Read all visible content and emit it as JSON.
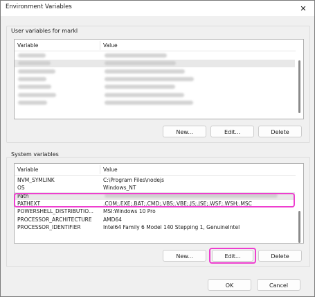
{
  "window": {
    "title": "Environment Variables",
    "close_icon": "close-icon"
  },
  "user_group": {
    "label": "User variables for markl",
    "columns": [
      "Variable",
      "Value"
    ],
    "rows": [
      {
        "variable": "",
        "value": ""
      },
      {
        "variable": "",
        "value": ""
      },
      {
        "variable": "",
        "value": ""
      },
      {
        "variable": "",
        "value": ""
      },
      {
        "variable": "",
        "value": ""
      },
      {
        "variable": "",
        "value": ""
      },
      {
        "variable": "",
        "value": ""
      }
    ],
    "buttons": {
      "new": "New...",
      "edit": "Edit...",
      "delete": "Delete"
    }
  },
  "system_group": {
    "label": "System variables",
    "columns": [
      "Variable",
      "Value"
    ],
    "rows": [
      {
        "variable": "NVM_SYMLINK",
        "value": "C:\\Program Files\\nodejs"
      },
      {
        "variable": "OS",
        "value": "Windows_NT"
      },
      {
        "variable": "Path",
        "value": ""
      },
      {
        "variable": "PATHEXT",
        "value": ".COM;.EXE;.BAT;.CMD;.VBS;.VBE;.JS;.JSE;.WSF;.WSH;.MSC"
      },
      {
        "variable": "POWERSHELL_DISTRIBUTIO...",
        "value": "MSI:Windows 10 Pro"
      },
      {
        "variable": "PROCESSOR_ARCHITECTURE",
        "value": "AMD64"
      },
      {
        "variable": "PROCESSOR_IDENTIFIER",
        "value": "Intel64 Family 6 Model 140 Stepping 1, GenuineIntel"
      }
    ],
    "buttons": {
      "new": "New...",
      "edit": "Edit...",
      "delete": "Delete"
    }
  },
  "footer": {
    "ok": "OK",
    "cancel": "Cancel"
  },
  "colors": {
    "highlight": "#ee3ecf",
    "accent": "#0067c0"
  }
}
